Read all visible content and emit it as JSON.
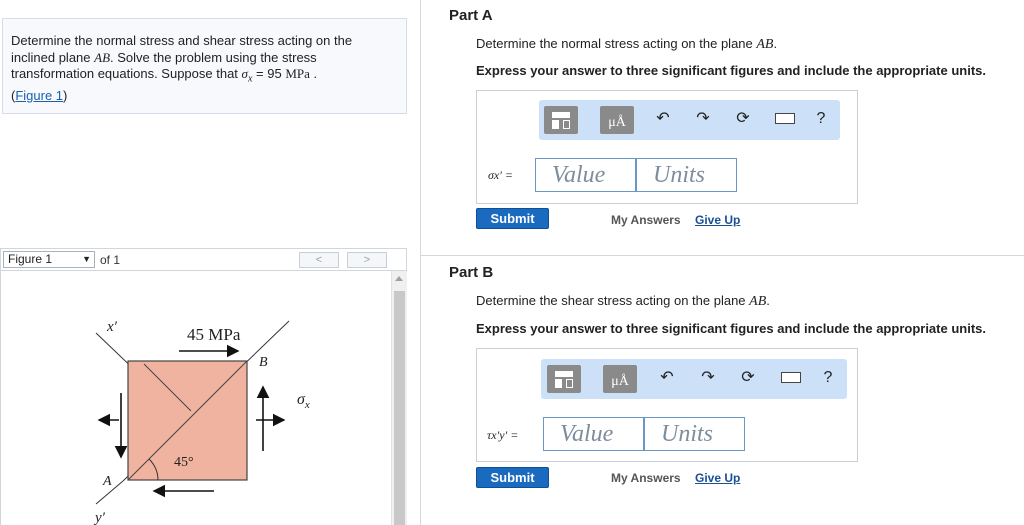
{
  "problem": {
    "line1": "Determine the normal stress and shear stress acting on the",
    "line2_pre": "inclined plane ",
    "line2_plane": "AB",
    "line2_post": ". Solve the problem using the stress",
    "line3_pre": "transformation equations. Suppose that ",
    "line3_sigma": "σ",
    "line3_sub": "x",
    "line3_eq": " = 95 ",
    "line3_unit": "MPa",
    "line3_end": " .",
    "link_open": "(",
    "link_text": "Figure 1",
    "link_close": ")"
  },
  "figure_nav": {
    "selected": "Figure 1",
    "of_text": "of 1",
    "prev": "<",
    "next": ">"
  },
  "figure": {
    "x_prime": "x′",
    "y_prime": "y′",
    "stress_label": "45 MPa",
    "point_a": "A",
    "point_b": "B",
    "sigma": "σ",
    "sigma_sub": "x",
    "angle": "45°"
  },
  "partA": {
    "title": "Part A",
    "prompt_pre": "Determine the normal stress acting on the plane ",
    "prompt_plane": "AB",
    "prompt_post": ".",
    "instruction": "Express your answer to three significant figures and include the appropriate units.",
    "eq_label": "σx′ =",
    "value_placeholder": "Value",
    "units_placeholder": "Units",
    "submit": "Submit",
    "my_answers": "My Answers",
    "give_up": "Give Up"
  },
  "partB": {
    "title": "Part B",
    "prompt_pre": "Determine the shear stress acting on the plane ",
    "prompt_plane": "AB",
    "prompt_post": ".",
    "instruction": "Express your answer to three significant figures and include the appropriate units.",
    "eq_label": "τx′y′ =",
    "value_placeholder": "Value",
    "units_placeholder": "Units",
    "submit": "Submit",
    "my_answers": "My Answers",
    "give_up": "Give Up"
  },
  "toolbar": {
    "units_icon_text": "μÅ",
    "help_text": "?",
    "icons": [
      "templates-icon",
      "units-icon",
      "undo-icon",
      "redo-icon",
      "reset-icon",
      "keyboard-icon",
      "help-icon"
    ]
  },
  "colors": {
    "figure_fill": "#f0b3a0",
    "toolbar_bg": "#cce0f7",
    "submit_bg": "#1a6ac0",
    "link": "#1a5fb4"
  }
}
